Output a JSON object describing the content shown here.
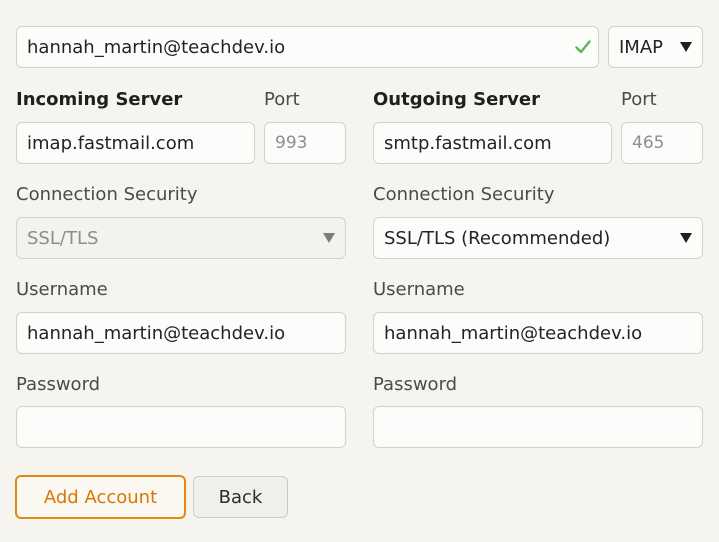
{
  "account": {
    "email": "hannah_martin@teachdev.io",
    "protocol": "IMAP"
  },
  "incoming": {
    "heading": "Incoming Server",
    "port_label": "Port",
    "server": "imap.fastmail.com",
    "port": "993",
    "security_label": "Connection Security",
    "security": "SSL/TLS",
    "username_label": "Username",
    "username": "hannah_martin@teachdev.io",
    "password_label": "Password",
    "password": ""
  },
  "outgoing": {
    "heading": "Outgoing Server",
    "port_label": "Port",
    "server": "smtp.fastmail.com",
    "port": "465",
    "security_label": "Connection Security",
    "security": "SSL/TLS (Recommended)",
    "username_label": "Username",
    "username": "hannah_martin@teachdev.io",
    "password_label": "Password",
    "password": ""
  },
  "actions": {
    "add_account": "Add Account",
    "back": "Back"
  },
  "colors": {
    "accent": "#e08914",
    "check": "#5cb85c",
    "background": "#f6f4ef"
  },
  "icons": {
    "valid": "check-icon",
    "dropdown": "chevron-down-icon"
  }
}
